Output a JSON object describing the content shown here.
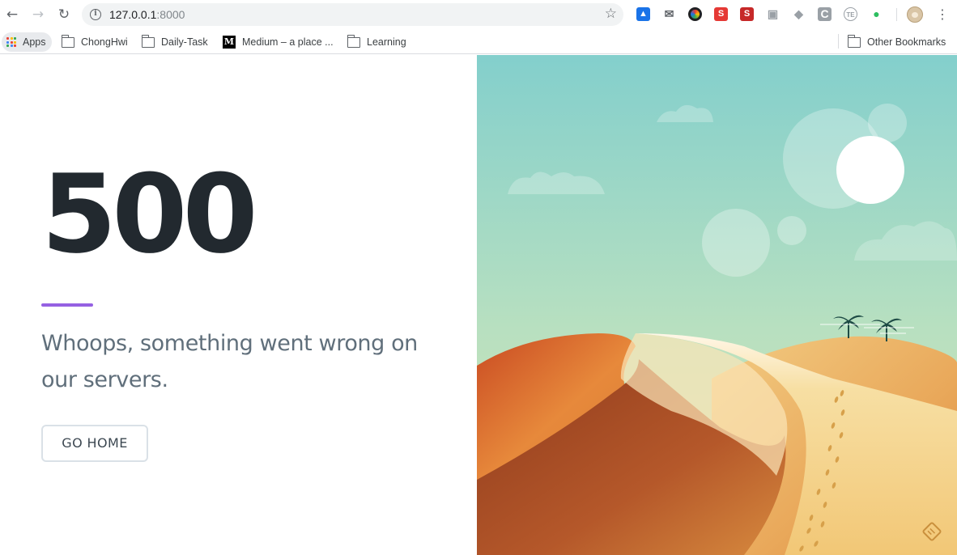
{
  "browser": {
    "back_icon": "arrow-left-icon",
    "forward_icon": "arrow-right-icon",
    "reload_icon": "reload-icon",
    "url_host": "127.0.0.1",
    "url_port": ":8000",
    "bookmark_star_icon": "star-icon",
    "extensions": [
      {
        "name": "blue-tray-extension-icon",
        "glyph": "▲",
        "color": "#1a73e8"
      },
      {
        "name": "mail-extension-icon",
        "glyph": "✉",
        "color": "#5f6368"
      },
      {
        "name": "color-wheel-extension-icon",
        "glyph": "",
        "color": "#202124"
      },
      {
        "name": "s-extension-icon",
        "glyph": "S",
        "color": "#e53935"
      },
      {
        "name": "seo-extension-icon",
        "glyph": "S",
        "color": "#c62828"
      },
      {
        "name": "tile-extension-icon",
        "glyph": "▣",
        "color": "#9aa0a6"
      },
      {
        "name": "tag-extension-icon",
        "glyph": "◆",
        "color": "#9aa0a6"
      },
      {
        "name": "c-extension-icon",
        "glyph": "C",
        "color": "#9aa0a6"
      },
      {
        "name": "te-extension-icon",
        "glyph": "TE",
        "color": "#9aa0a6"
      },
      {
        "name": "evernote-extension-icon",
        "glyph": "●",
        "color": "#2dbe60"
      }
    ]
  },
  "bookmarks": {
    "apps_label": "Apps",
    "items": [
      "ChongHwi",
      "Daily-Task",
      "Medium – a place ...",
      "Learning"
    ],
    "other_label": "Other Bookmarks",
    "apps_colors": [
      "#ea4335",
      "#fbbc04",
      "#34a853",
      "#4285f4",
      "#ea4335",
      "#fbbc04",
      "#34a853",
      "#4285f4",
      "#ea4335"
    ]
  },
  "error_page": {
    "code": "500",
    "message": "Whoops, something went wrong on our servers.",
    "button_label": "GO HOME",
    "accent_color": "#9561e2"
  }
}
